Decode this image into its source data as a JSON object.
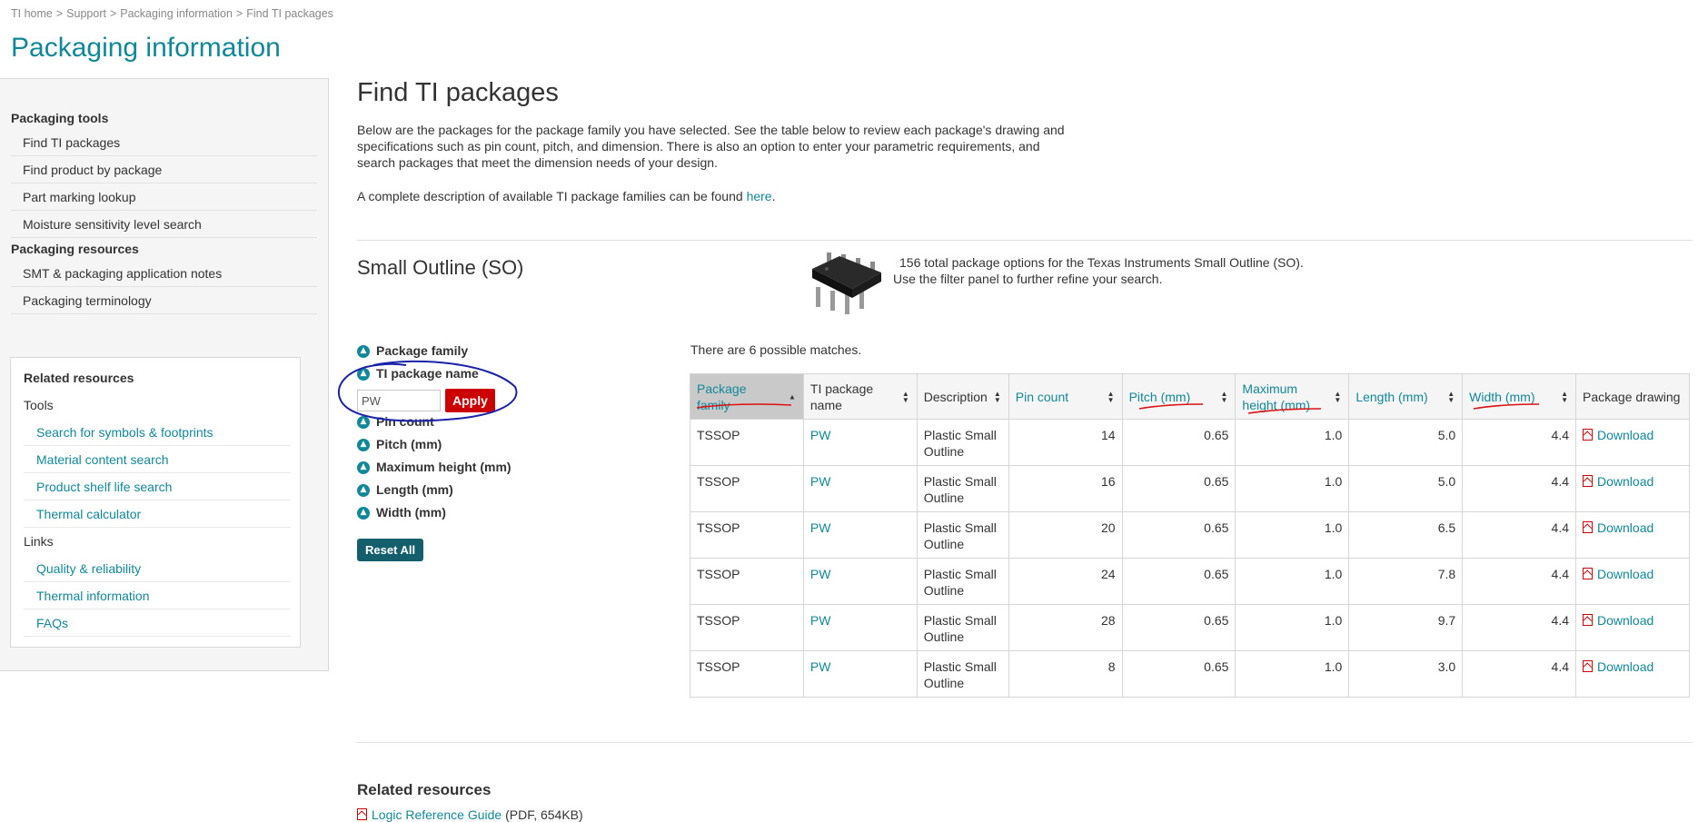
{
  "breadcrumb": [
    "TI home",
    "Support",
    "Packaging information",
    "Find TI packages"
  ],
  "breadcrumb_sep": ">",
  "page_title": "Packaging information",
  "sidebar": {
    "groups": [
      {
        "label": "Packaging tools",
        "items": [
          "Find TI packages",
          "Find product by package",
          "Part marking lookup",
          "Moisture sensitivity level search"
        ]
      },
      {
        "label": "Packaging resources",
        "items": [
          "SMT & packaging application notes",
          "Packaging terminology"
        ]
      }
    ],
    "related": {
      "title": "Related resources",
      "tools_label": "Tools",
      "tools": [
        "Search for symbols & footprints",
        "Material content search",
        "Product shelf life search",
        "Thermal calculator"
      ],
      "links_label": "Links",
      "links": [
        "Quality & reliability",
        "Thermal information",
        "FAQs"
      ]
    }
  },
  "main": {
    "heading": "Find TI packages",
    "intro": "Below are the packages for the package family you have selected. See the table below to review each package's drawing and specifications such as pin count, pitch, and dimension. There is also an option to enter your parametric requirements, and search packages that meet the dimension needs of your design.",
    "intro2_pre": "A complete description of available TI package families can be found ",
    "intro2_link": "here",
    "intro2_post": ".",
    "family_heading": "Small Outline (SO)",
    "total_line1": "156 total package options for the Texas Instruments Small Outline (SO).",
    "total_line2": "Use the filter panel to further refine your search."
  },
  "filters": {
    "items": [
      "Package family",
      "TI package name",
      "Pin count",
      "Pitch (mm)",
      "Maximum height (mm)",
      "Length (mm)",
      "Width (mm)"
    ],
    "input_value": "PW",
    "apply_label": "Apply",
    "reset_label": "Reset All"
  },
  "table": {
    "matches_text": "There are 6 possible matches.",
    "headers": [
      "Package family",
      "TI package name",
      "Description",
      "Pin count",
      "Pitch (mm)",
      "Maximum height (mm)",
      "Length (mm)",
      "Width (mm)",
      "Package drawing"
    ],
    "download_label": "Download",
    "rows": [
      [
        "TSSOP",
        "PW",
        "Plastic Small Outline",
        "14",
        "0.65",
        "1.0",
        "5.0",
        "4.4"
      ],
      [
        "TSSOP",
        "PW",
        "Plastic Small Outline",
        "16",
        "0.65",
        "1.0",
        "5.0",
        "4.4"
      ],
      [
        "TSSOP",
        "PW",
        "Plastic Small Outline",
        "20",
        "0.65",
        "1.0",
        "6.5",
        "4.4"
      ],
      [
        "TSSOP",
        "PW",
        "Plastic Small Outline",
        "24",
        "0.65",
        "1.0",
        "7.8",
        "4.4"
      ],
      [
        "TSSOP",
        "PW",
        "Plastic Small Outline",
        "28",
        "0.65",
        "1.0",
        "9.7",
        "4.4"
      ],
      [
        "TSSOP",
        "PW",
        "Plastic Small Outline",
        "8",
        "0.65",
        "1.0",
        "3.0",
        "4.4"
      ]
    ]
  },
  "footer": {
    "related_heading": "Related resources",
    "ref_link": "Logic Reference Guide",
    "ref_meta": " (PDF, 654KB)"
  },
  "colors": {
    "accent": "#118899",
    "apply": "#cc0000",
    "reset": "#155f6c",
    "annotation": "#1a22a8",
    "underline": "#dd1111"
  }
}
